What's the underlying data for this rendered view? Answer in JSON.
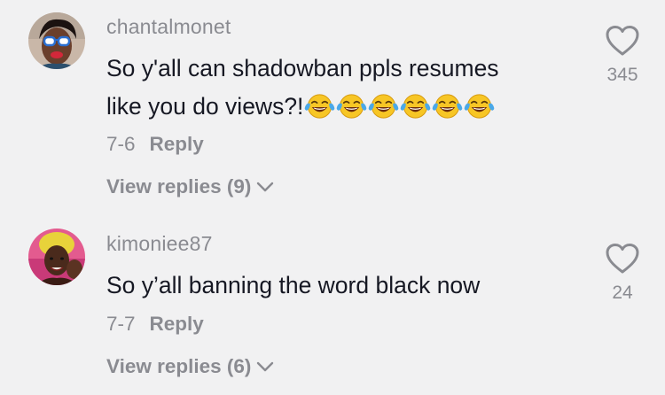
{
  "comments": [
    {
      "username": "chantalmonet",
      "text_line1": "So y'all can shadowban ppls resumes",
      "text_line2": "like you do views?!",
      "emoji_count": 6,
      "emoji_icon": "face-with-tears-of-joy-icon",
      "date": "7-6",
      "reply_label": "Reply",
      "view_replies": "View replies (9)",
      "likes": "345"
    },
    {
      "username": "kimoniee87",
      "text_line1": "So y’all banning the word black now",
      "date": "7-7",
      "reply_label": "Reply",
      "view_replies": "View replies (6)",
      "likes": "24"
    }
  ],
  "icons": {
    "like": "heart-outline-icon",
    "expand": "chevron-down-icon"
  },
  "colors": {
    "background": "#f1f1f2",
    "username": "#8a8b91",
    "text": "#161823",
    "meta": "#8a8b91"
  }
}
